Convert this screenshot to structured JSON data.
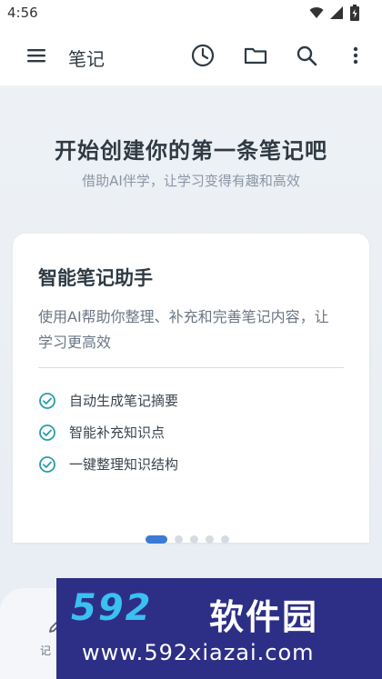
{
  "status_bar": {
    "time": "4:56"
  },
  "app_bar": {
    "title": "笔记",
    "icons": [
      "menu-icon",
      "clock-icon",
      "folder-icon",
      "search-icon",
      "more-vertical-icon"
    ]
  },
  "hero": {
    "title": "开始创建你的第一条笔记吧",
    "subtitle": "借助AI伴学，让学习变得有趣和高效"
  },
  "card": {
    "title": "智能笔记助手",
    "description": "使用AI帮助你整理、补充和完善笔记内容，让学习更高效",
    "features": [
      {
        "label": "自动生成笔记摘要",
        "icon": "check-circle-icon"
      },
      {
        "label": "智能补充知识点",
        "icon": "check-circle-icon"
      },
      {
        "label": "一键整理知识结构",
        "icon": "check-circle-icon"
      }
    ]
  },
  "pager": {
    "total": 5,
    "active_index": 0
  },
  "bottom_nav": {
    "record_label": "记"
  },
  "watermark": {
    "logo": "592",
    "logo_cn": "软件园",
    "url": "www.592xiazai.com"
  },
  "colors": {
    "accent": "#3a7bd5",
    "check": "#2a9da8",
    "background": "#eef2f6",
    "watermark_bg": "#2d2f86",
    "watermark_logo": "#3bc0f2"
  }
}
